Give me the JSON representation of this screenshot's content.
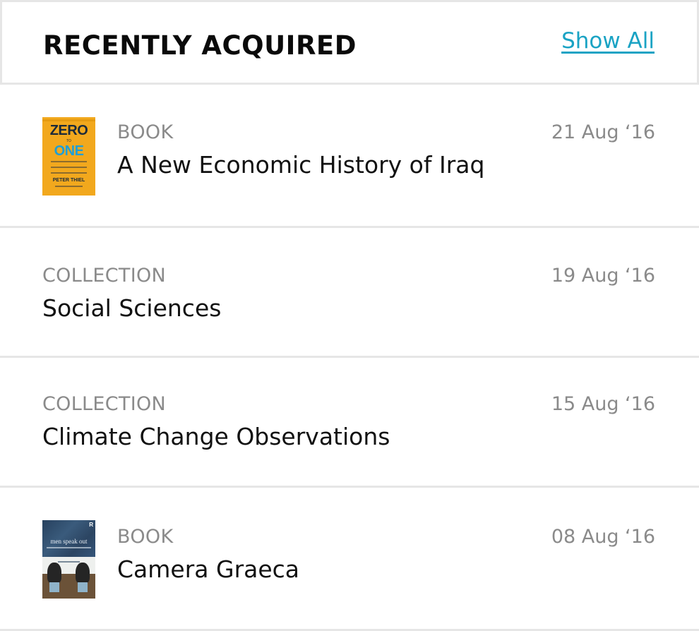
{
  "header": {
    "title": "RECENTLY ACQUIRED",
    "show_all_label": "Show All"
  },
  "items": [
    {
      "kind": "BOOK",
      "title": "A New Economic History of Iraq",
      "date": "21 Aug ‘16",
      "thumbnail": "book-cover-zero-to-one",
      "cover_text": {
        "word1": "ZERO",
        "to": "TO",
        "word2": "ONE",
        "author": "PETER THIEL"
      }
    },
    {
      "kind": "COLLECTION",
      "title": "Social Sciences",
      "date": "19 Aug ‘16"
    },
    {
      "kind": "COLLECTION",
      "title": "Climate Change Observations",
      "date": "15 Aug ‘16"
    },
    {
      "kind": "BOOK",
      "title": "Camera Graeca",
      "date": "08 Aug ‘16",
      "thumbnail": "book-cover-men-speak-out",
      "cover_text": {
        "title": "men speak out",
        "logo": "R"
      }
    }
  ],
  "colors": {
    "link": "#1aa3c4",
    "meta_text": "#8a8a8a",
    "title_text": "#111111",
    "divider": "#e6e6e6"
  }
}
